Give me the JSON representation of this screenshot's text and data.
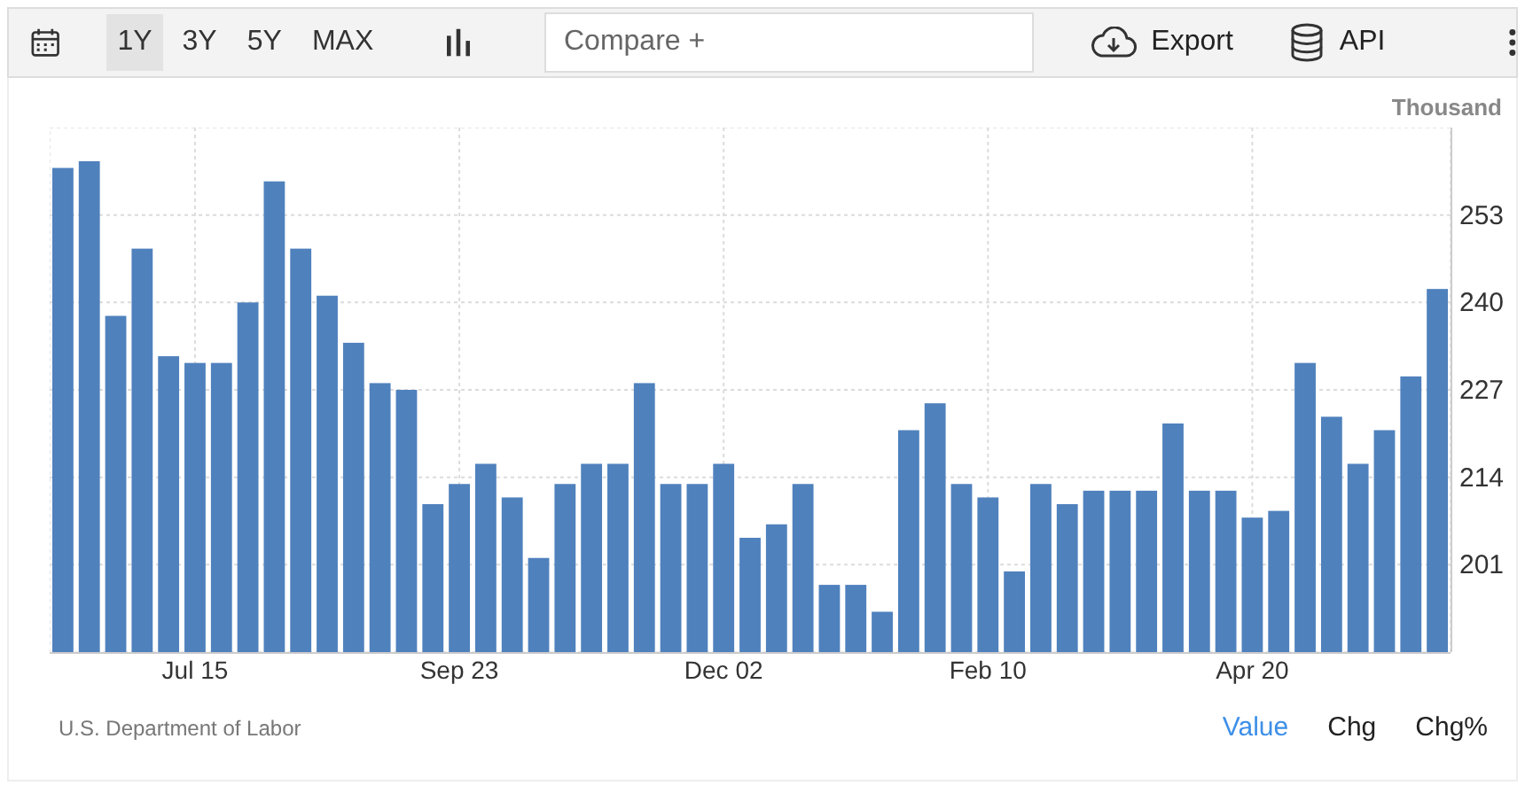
{
  "toolbar": {
    "ranges": [
      {
        "label": "1Y",
        "selected": true
      },
      {
        "label": "3Y",
        "selected": false
      },
      {
        "label": "5Y",
        "selected": false
      },
      {
        "label": "MAX",
        "selected": false
      }
    ],
    "compare": {
      "placeholder": "Compare +"
    },
    "export": "Export",
    "api": "API"
  },
  "unit": "Thousand",
  "chart_data": {
    "type": "bar",
    "color": "#4f81bd",
    "ylim": [
      188,
      266
    ],
    "yticks": [
      201,
      214,
      227,
      240,
      253
    ],
    "grid": true,
    "categories": [
      null,
      null,
      null,
      null,
      null,
      "Jul 15",
      null,
      null,
      null,
      null,
      null,
      null,
      null,
      null,
      null,
      "Sep 23",
      null,
      null,
      null,
      null,
      null,
      null,
      null,
      null,
      null,
      "Dec 02",
      null,
      null,
      null,
      null,
      null,
      null,
      null,
      null,
      null,
      "Feb 10",
      null,
      null,
      null,
      null,
      null,
      null,
      null,
      null,
      null,
      "Apr 20",
      null,
      null,
      null,
      null,
      null,
      null,
      null
    ],
    "values": [
      260,
      261,
      238,
      248,
      232,
      231,
      231,
      240,
      258,
      248,
      241,
      234,
      228,
      227,
      210,
      213,
      216,
      211,
      202,
      213,
      216,
      216,
      228,
      213,
      213,
      216,
      205,
      207,
      213,
      198,
      198,
      194,
      221,
      225,
      213,
      211,
      200,
      213,
      210,
      212,
      212,
      212,
      222,
      212,
      212,
      208,
      209,
      231,
      223,
      216,
      221,
      229,
      242
    ]
  },
  "source": "U.S. Department of Labor",
  "views": [
    {
      "label": "Value",
      "selected": true
    },
    {
      "label": "Chg",
      "selected": false
    },
    {
      "label": "Chg%",
      "selected": false
    }
  ]
}
